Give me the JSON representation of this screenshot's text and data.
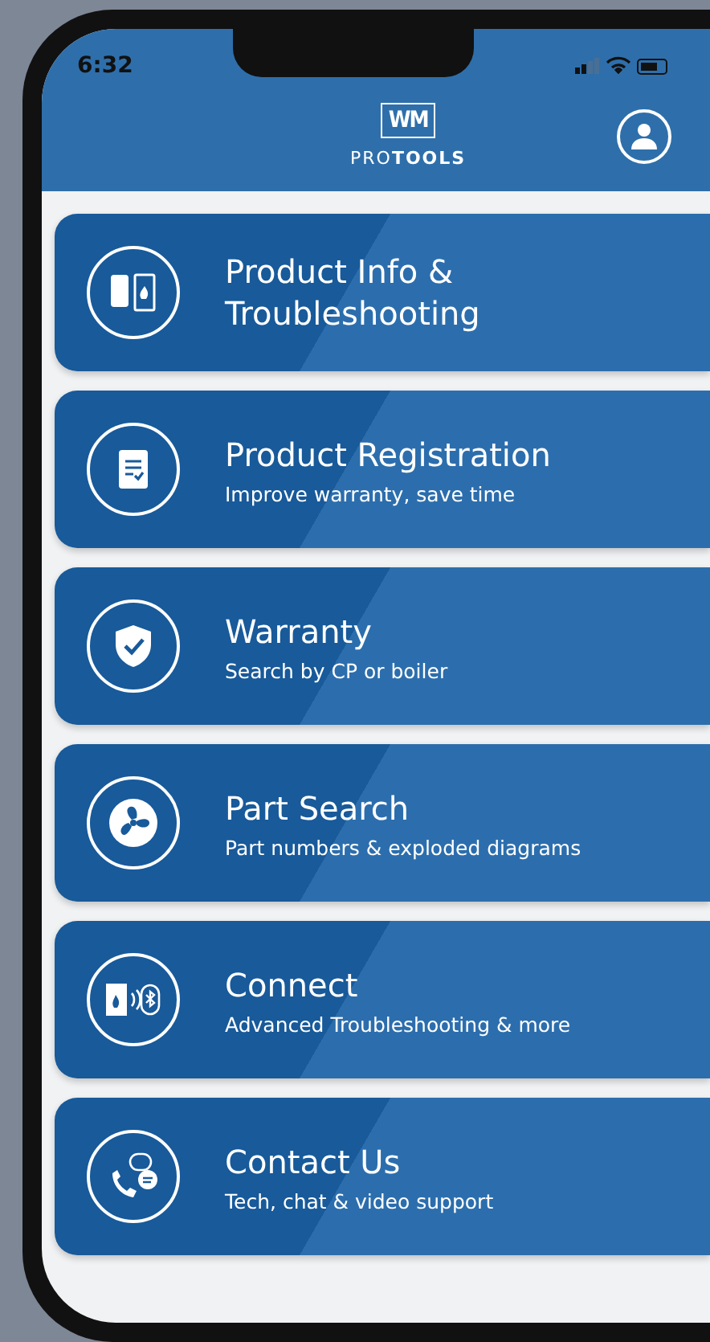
{
  "status_bar": {
    "time": "6:32"
  },
  "header": {
    "logo_text": "WM",
    "brand": "PRO**TOOLS**"
  },
  "menu": [
    {
      "title": "Product Info & Troubleshooting"
    },
    {
      "title": "Product Registration",
      "subtitle": "Improve warranty, save time"
    },
    {
      "title": "Warranty",
      "subtitle": "Search by CP or boiler"
    },
    {
      "title": "Part Search",
      "subtitle": "Part numbers & exploded diagrams"
    },
    {
      "title": "Connect",
      "subtitle": "Advanced Troubleshooting & more"
    },
    {
      "title": "Contact Us",
      "subtitle": "Tech, chat & video support"
    }
  ]
}
